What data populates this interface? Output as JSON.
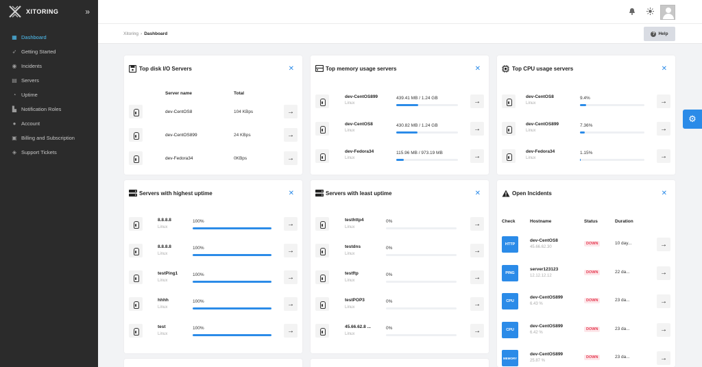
{
  "brand": {
    "name": "XITORING"
  },
  "sidebar": {
    "items": [
      {
        "label": "Dashboard",
        "icon": "dashboard-icon",
        "active": true
      },
      {
        "label": "Getting Started",
        "icon": "rocket-icon"
      },
      {
        "label": "Incidents",
        "icon": "incidents-icon"
      },
      {
        "label": "Servers",
        "icon": "servers-icon"
      },
      {
        "label": "Uptime",
        "icon": "uptime-icon"
      },
      {
        "label": "Notification Roles",
        "icon": "notification-roles-icon"
      },
      {
        "label": "Account",
        "icon": "account-icon"
      },
      {
        "label": "Billing and Subscription",
        "icon": "billing-icon"
      },
      {
        "label": "Support Tickets",
        "icon": "support-icon"
      }
    ]
  },
  "breadcrumb": {
    "root": "Xitoring",
    "sep": "›",
    "current": "Dashboard"
  },
  "help": {
    "label": "Help"
  },
  "accent": "#2b8be8",
  "cards": {
    "disk": {
      "title": "Top disk I/O Servers",
      "col_name": "Server name",
      "col_total": "Total",
      "rows": [
        {
          "name": "dev-CentOS8",
          "total": "104 KBps"
        },
        {
          "name": "dev-CentOS899",
          "total": "24 KBps"
        },
        {
          "name": "dev-Fedora34",
          "total": "0KBps"
        }
      ]
    },
    "memory": {
      "title": "Top memory usage servers",
      "rows": [
        {
          "name": "dev-CentOS899",
          "os": "Linux",
          "usage": "439.41 MB / 1.24 GB",
          "fraction": 0.35
        },
        {
          "name": "dev-CentOS8",
          "os": "Linux",
          "usage": "430.82 MB / 1.24 GB",
          "fraction": 0.34
        },
        {
          "name": "dev-Fedora34",
          "os": "Linux",
          "usage": "115.96 MB / 973.19 MB",
          "fraction": 0.12
        }
      ]
    },
    "cpu": {
      "title": "Top CPU usage servers",
      "rows": [
        {
          "name": "dev-CentOS8",
          "os": "Linux",
          "usage": "9.4%",
          "fraction": 0.094
        },
        {
          "name": "dev-CentOS899",
          "os": "Linux",
          "usage": "7.36%",
          "fraction": 0.0736
        },
        {
          "name": "dev-Fedora34",
          "os": "Linux",
          "usage": "1.15%",
          "fraction": 0.0115
        }
      ]
    },
    "high_uptime": {
      "title": "Servers with highest uptime",
      "rows": [
        {
          "name": "8.8.8.8",
          "os": "Linux",
          "pct": "100%",
          "fraction": 1
        },
        {
          "name": "8.8.8.8",
          "os": "Linux",
          "pct": "100%",
          "fraction": 1
        },
        {
          "name": "testPing1",
          "os": "Linux",
          "pct": "100%",
          "fraction": 1
        },
        {
          "name": "hhhh",
          "os": "Linux",
          "pct": "100%",
          "fraction": 1
        },
        {
          "name": "test",
          "os": "Linux",
          "pct": "100%",
          "fraction": 1
        }
      ]
    },
    "least_uptime": {
      "title": "Servers with least uptime",
      "rows": [
        {
          "name": "testhttp4",
          "os": "Linux",
          "pct": "0%",
          "fraction": 0
        },
        {
          "name": "testdns",
          "os": "Linux",
          "pct": "0%",
          "fraction": 0
        },
        {
          "name": "testftp",
          "os": "Linux",
          "pct": "0%",
          "fraction": 0
        },
        {
          "name": "testPOP3",
          "os": "Linux",
          "pct": "0%",
          "fraction": 0
        },
        {
          "name": "45.66.62.8 ...",
          "os": "Linux",
          "pct": "0%",
          "fraction": 0
        }
      ]
    },
    "incidents": {
      "title": "Open Incidents",
      "col_check": "Check",
      "col_host": "Hostname",
      "col_status": "Status",
      "col_duration": "Duration",
      "rows": [
        {
          "check": "HTTP",
          "host": "dev-CentOS8",
          "sub": "45.66.62.30",
          "status": "DOWN",
          "duration": "10 day..."
        },
        {
          "check": "PING",
          "host": "server123123",
          "sub": "12.12.12.12",
          "status": "DOWN",
          "duration": "22 da..."
        },
        {
          "check": "CPU",
          "host": "dev-CentOS899",
          "sub": "6.43 %",
          "status": "DOWN",
          "duration": "23 da..."
        },
        {
          "check": "CPU",
          "host": "dev-CentOS899",
          "sub": "6.42 %",
          "status": "DOWN",
          "duration": "23 da..."
        },
        {
          "check": "MEMORY",
          "host": "dev-CentOS899",
          "sub": "25.87 %",
          "status": "DOWN",
          "duration": "23 da..."
        }
      ]
    }
  }
}
